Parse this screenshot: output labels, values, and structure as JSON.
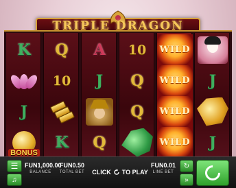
{
  "title": {
    "text": "TRIPLE DRAGON"
  },
  "reels": [
    {
      "symbols": [
        {
          "type": "letter",
          "value": "K",
          "cls": "sym-K"
        },
        {
          "type": "icon",
          "icon": "lotus-icon"
        },
        {
          "type": "letter",
          "value": "J",
          "cls": "sym-J"
        },
        {
          "type": "bonus",
          "label": "BONUS"
        }
      ]
    },
    {
      "symbols": [
        {
          "type": "letter",
          "value": "Q",
          "cls": "sym-Q"
        },
        {
          "type": "letter",
          "value": "10",
          "cls": "sym-10"
        },
        {
          "type": "icon",
          "icon": "gold-tiles-icon"
        },
        {
          "type": "letter",
          "value": "K",
          "cls": "sym-K"
        }
      ]
    },
    {
      "symbols": [
        {
          "type": "letter",
          "value": "A",
          "cls": "sym-A"
        },
        {
          "type": "letter",
          "value": "J",
          "cls": "sym-J"
        },
        {
          "type": "icon",
          "icon": "samurai-icon"
        },
        {
          "type": "letter",
          "value": "Q",
          "cls": "sym-Q"
        }
      ]
    },
    {
      "symbols": [
        {
          "type": "letter",
          "value": "10",
          "cls": "sym-10"
        },
        {
          "type": "letter",
          "value": "Q",
          "cls": "sym-Q"
        },
        {
          "type": "letter",
          "value": "Q",
          "cls": "sym-Q"
        },
        {
          "type": "icon",
          "icon": "green-dragon-icon"
        }
      ]
    },
    {
      "symbols": [
        {
          "type": "wild",
          "label": "WILD"
        },
        {
          "type": "wild",
          "label": "WILD"
        },
        {
          "type": "wild",
          "label": "WILD"
        },
        {
          "type": "wild",
          "label": "WILD"
        }
      ]
    },
    {
      "symbols": [
        {
          "type": "icon",
          "icon": "geisha-icon"
        },
        {
          "type": "letter",
          "value": "J",
          "cls": "sym-J"
        },
        {
          "type": "icon",
          "icon": "gold-dragon-icon"
        },
        {
          "type": "letter",
          "value": "J",
          "cls": "sym-J"
        }
      ]
    }
  ],
  "bottom_bar": {
    "balance": {
      "value": "FUN1,000.00",
      "label": "BALANCE"
    },
    "total_bet": {
      "value": "FUN0.50",
      "label": "TOTAL BET"
    },
    "play_prompt": "CLICK",
    "play_prompt_suffix": "TO PLAY",
    "line_bet": {
      "value": "FUN0.01",
      "label": "LINE BET"
    },
    "menu_icon": "menu-icon",
    "sound_icon": "sound-icon",
    "autoplay_icon": "autoplay-icon",
    "turbo_icon": "fast-forward-icon",
    "spin_icon": "spin-icon"
  },
  "colors": {
    "accent_gold": "#d8a33a",
    "button_green": "#2ea02a",
    "reel_bg": "#5b0f18"
  }
}
